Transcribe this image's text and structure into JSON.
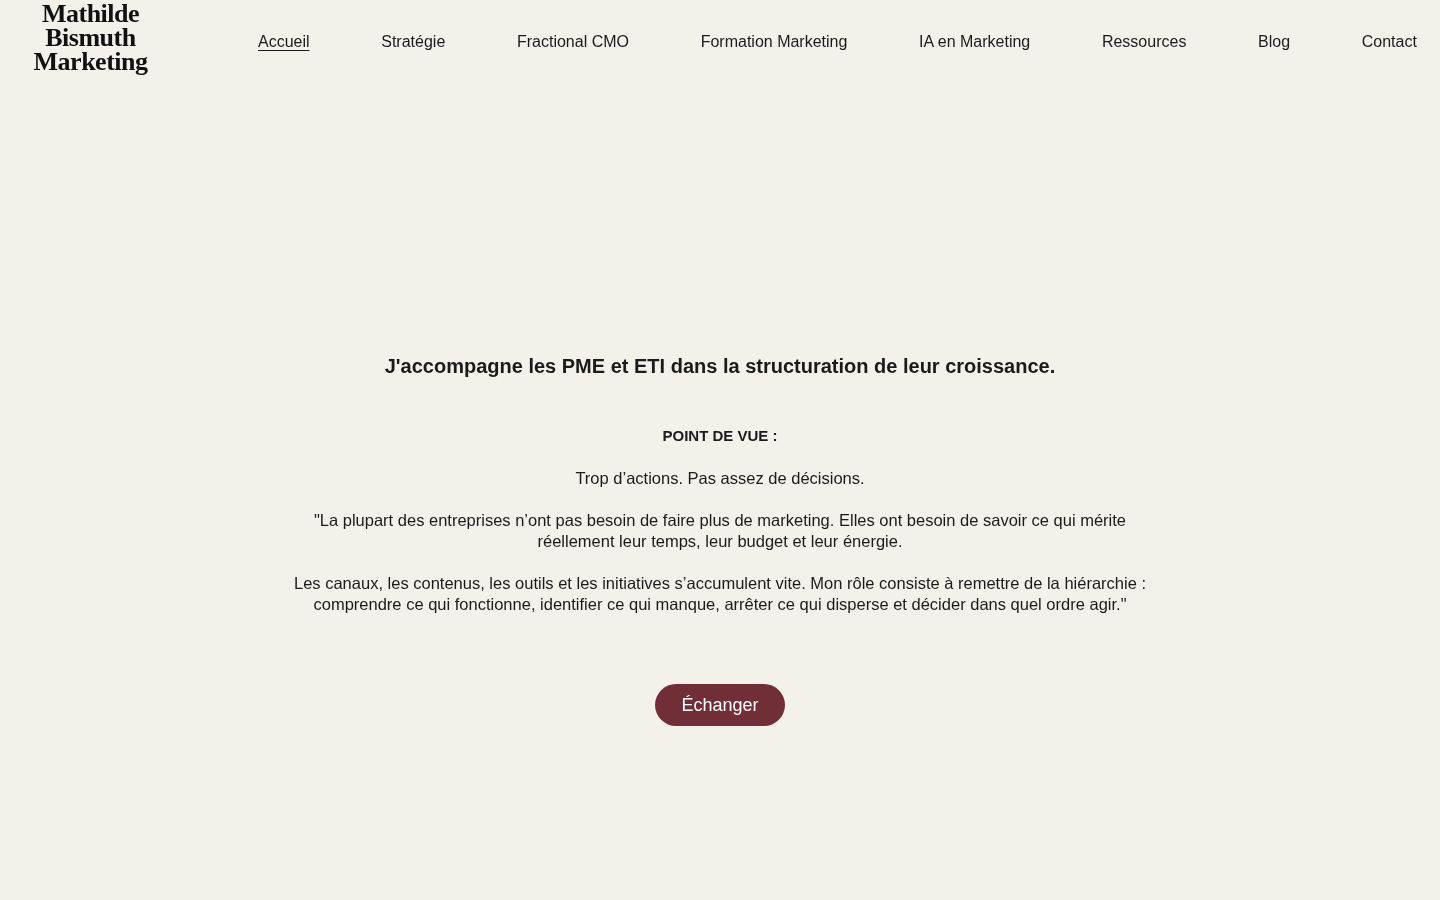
{
  "header": {
    "logo": [
      "Mathilde",
      "Bismuth",
      "Marketing"
    ],
    "nav": [
      {
        "label": "Accueil",
        "selected": true
      },
      {
        "label": "Stratégie",
        "selected": false
      },
      {
        "label": "Fractional CMO",
        "selected": false
      },
      {
        "label": "Formation Marketing",
        "selected": false
      },
      {
        "label": "IA en Marketing",
        "selected": false
      },
      {
        "label": "Ressources",
        "selected": false
      },
      {
        "label": "Blog",
        "selected": false
      },
      {
        "label": "Contact",
        "selected": false
      }
    ]
  },
  "hero": {
    "heading": "J'accompagne les PME et ETI dans la structuration de leur croissance.",
    "section_label": "POINT DE VUE :",
    "paragraphs": [
      "Trop d’actions. Pas assez de décisions.",
      "\"La plupart des entreprises n’ont pas besoin de faire plus de marketing. Elles ont besoin de savoir ce qui mérite réellement leur temps, leur budget et leur énergie.",
      "Les canaux, les contenus, les outils et les initiatives s’accumulent vite. Mon rôle consiste à remettre de la hiérarchie : comprendre ce qui fonctionne, identifier ce qui manque, arrêter ce qui disperse et décider dans quel ordre agir.\""
    ],
    "cta": "Échanger"
  }
}
